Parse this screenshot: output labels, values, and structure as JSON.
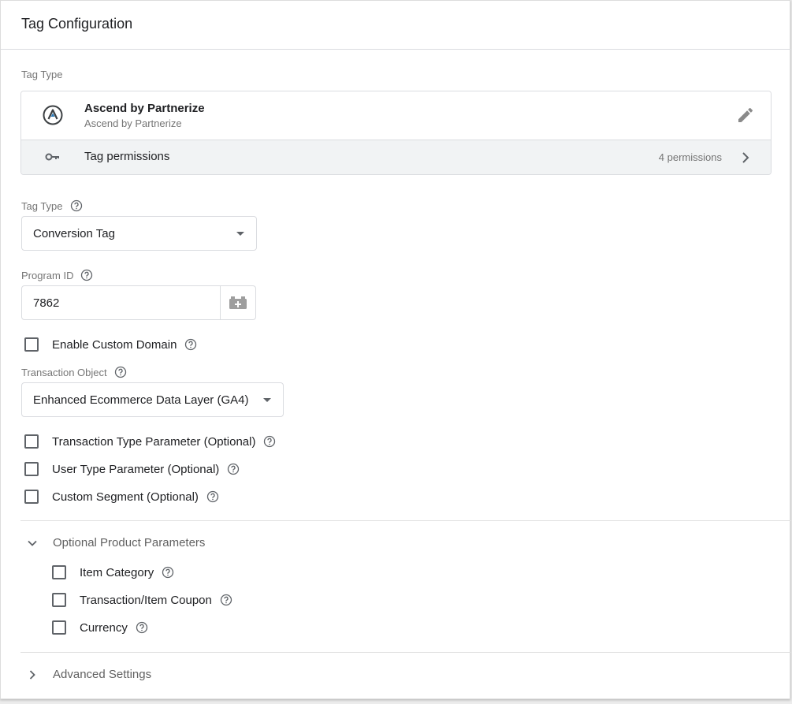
{
  "card": {
    "title": "Tag Configuration"
  },
  "tag_type_section": {
    "label": "Tag Type",
    "template": {
      "name": "Ascend by Partnerize",
      "subtitle": "Ascend by Partnerize",
      "logo_icon": "partnerize-logo-icon",
      "edit_icon": "pencil-icon"
    },
    "permissions": {
      "label": "Tag permissions",
      "count": "4 permissions",
      "icon": "key-icon"
    }
  },
  "fields": {
    "tag_type": {
      "label": "Tag Type",
      "value": "Conversion Tag"
    },
    "program_id": {
      "label": "Program ID",
      "value": "7862",
      "variable_icon": "variable-brick-icon"
    },
    "enable_custom_domain": {
      "label": "Enable Custom Domain",
      "checked": false
    },
    "transaction_object": {
      "label": "Transaction Object",
      "value": "Enhanced Ecommerce Data Layer (GA4)"
    },
    "transaction_type_param": {
      "label": "Transaction Type Parameter (Optional)",
      "checked": false
    },
    "user_type_param": {
      "label": "User Type Parameter (Optional)",
      "checked": false
    },
    "custom_segment": {
      "label": "Custom Segment (Optional)",
      "checked": false
    }
  },
  "optional_product_parameters": {
    "title": "Optional Product Parameters",
    "expanded": true,
    "items": [
      {
        "label": "Item Category",
        "checked": false
      },
      {
        "label": "Transaction/Item Coupon",
        "checked": false
      },
      {
        "label": "Currency",
        "checked": false
      }
    ]
  },
  "advanced_settings": {
    "title": "Advanced Settings",
    "expanded": false
  },
  "colors": {
    "text": "#202124",
    "secondary": "#757575",
    "border": "#dadce0",
    "permissions_bg": "#f1f3f4"
  }
}
